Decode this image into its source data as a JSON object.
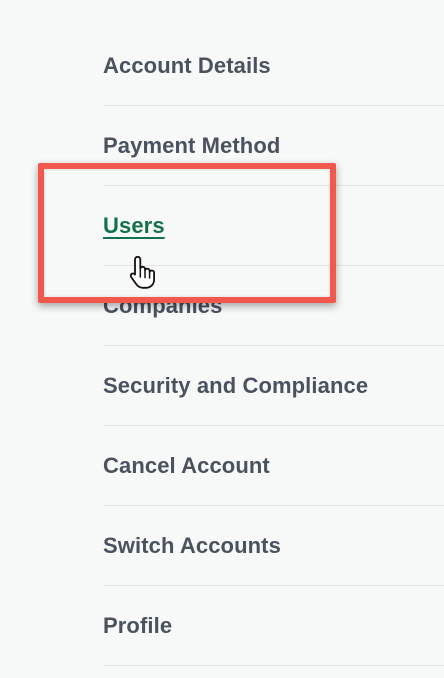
{
  "settings_menu": {
    "items": [
      {
        "label": "Account Details"
      },
      {
        "label": "Payment Method"
      },
      {
        "label": "Users",
        "active": true
      },
      {
        "label": "Companies"
      },
      {
        "label": "Security and Compliance"
      },
      {
        "label": "Cancel Account"
      },
      {
        "label": "Switch Accounts"
      },
      {
        "label": "Profile"
      }
    ]
  },
  "annotation": {
    "highlight_color": "#f2584c",
    "cursor_icon": "hand-pointer-icon"
  },
  "colors": {
    "text": "#4a5260",
    "active_text": "#17704d",
    "divider": "#e3e5e6",
    "background": "#f7f8f8"
  }
}
